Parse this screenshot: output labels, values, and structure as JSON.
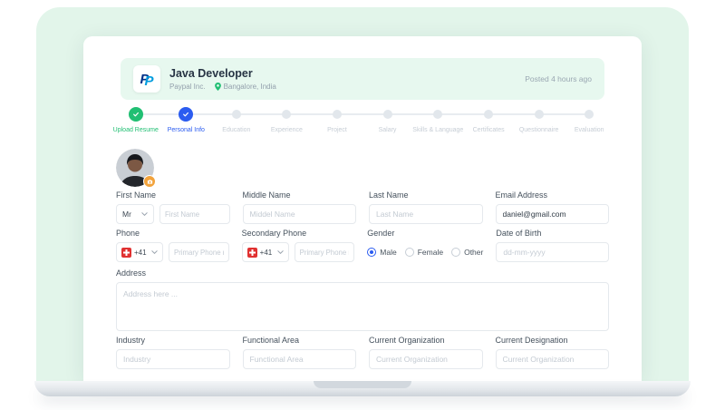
{
  "header": {
    "job_title": "Java Developer",
    "company": "Paypal Inc.",
    "location": "Bangalore, India",
    "posted": "Posted 4 hours ago"
  },
  "stepper": {
    "steps": [
      {
        "label": "Upload Resume",
        "state": "completed"
      },
      {
        "label": "Personal Info",
        "state": "active"
      },
      {
        "label": "Education",
        "state": "pending"
      },
      {
        "label": "Experience",
        "state": "pending"
      },
      {
        "label": "Project",
        "state": "pending"
      },
      {
        "label": "Salary",
        "state": "pending"
      },
      {
        "label": "Skills & Language",
        "state": "pending"
      },
      {
        "label": "Certificates",
        "state": "pending"
      },
      {
        "label": "Questionnaire",
        "state": "pending"
      },
      {
        "label": "Evaluation",
        "state": "pending"
      }
    ]
  },
  "form": {
    "first_name": {
      "label": "First Name",
      "salutation": "Mr",
      "placeholder": "First Name"
    },
    "middle_name": {
      "label": "Middle Name",
      "placeholder": "Middel Name"
    },
    "last_name": {
      "label": "Last Name",
      "placeholder": "Last Name"
    },
    "email": {
      "label": "Email Address",
      "value": "daniel@gmail.com"
    },
    "phone": {
      "label": "Phone",
      "dial_code": "+41",
      "placeholder": "Primary Phone no."
    },
    "secondary_phone": {
      "label": "Secondary Phone",
      "dial_code": "+41",
      "placeholder": "Primary Phone no."
    },
    "gender": {
      "label": "Gender",
      "options": [
        "Male",
        "Female",
        "Other"
      ],
      "selected": "Male"
    },
    "dob": {
      "label": "Date of Birth",
      "placeholder": "dd-mm-yyyy"
    },
    "address": {
      "label": "Address",
      "placeholder": "Address here ..."
    },
    "industry": {
      "label": "Industry",
      "placeholder": "Industry"
    },
    "functional_area": {
      "label": "Functional Area",
      "placeholder": "Functional Area"
    },
    "current_organization": {
      "label": "Current Organization",
      "placeholder": "Current Organization"
    },
    "current_designation": {
      "label": "Current Designation",
      "placeholder": "Current Organization"
    }
  },
  "colors": {
    "accent_green": "#21bf73",
    "accent_blue": "#2b5cf0",
    "mint_background": "#e2f5ea",
    "header_card_background": "#e7f8ef",
    "badge_orange": "#f2a33c",
    "flag_red": "#e03131"
  }
}
